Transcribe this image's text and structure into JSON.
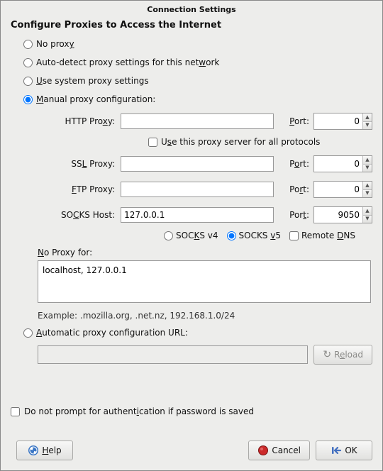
{
  "title": "Connection Settings",
  "heading": "Configure Proxies to Access the Internet",
  "radios": {
    "no_proxy": "No proxy",
    "auto_detect": "Auto-detect proxy settings for this network",
    "system": "Use system proxy settings",
    "manual": "Manual proxy configuration:",
    "automatic_url": "Automatic proxy configuration URL:"
  },
  "selected_radio": "manual",
  "labels": {
    "http": "HTTP Proxy:",
    "use_all": "Use this proxy server for all protocols",
    "ssl": "SSL Proxy:",
    "ftp": "FTP Proxy:",
    "socks": "SOCKS Host:",
    "port": "Port:",
    "socks_v4": "SOCKS v4",
    "socks_v5": "SOCKS v5",
    "remote_dns": "Remote DNS",
    "noproxy_for": "No Proxy for:",
    "example": "Example: .mozilla.org, .net.nz, 192.168.1.0/24",
    "reload": "Reload",
    "dont_prompt": "Do not prompt for authentication if password is saved",
    "help": "Help",
    "cancel": "Cancel",
    "ok": "OK"
  },
  "values": {
    "http_host": "",
    "http_port": "0",
    "use_all": false,
    "ssl_host": "",
    "ssl_port": "0",
    "ftp_host": "",
    "ftp_port": "0",
    "socks_host": "127.0.0.1",
    "socks_port": "9050",
    "socks_version": "v5",
    "remote_dns": false,
    "no_proxy": "localhost, 127.0.0.1",
    "pac_url": "",
    "dont_prompt": false
  },
  "icons": {
    "help": "help-icon",
    "cancel": "stop-icon",
    "ok": "ok-icon",
    "reload": "reload-icon"
  },
  "colors": {
    "bg": "#ededeb",
    "border": "#999999",
    "accent_blue": "#3a76c5",
    "stop_red": "#cc2a2a",
    "ok_blue": "#4370c0"
  }
}
